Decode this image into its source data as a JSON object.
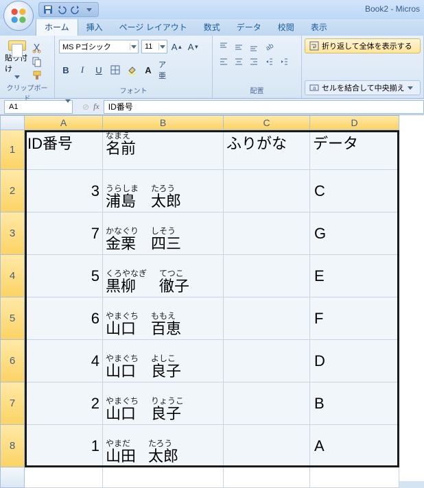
{
  "window": {
    "title": "Book2 - Micros"
  },
  "tabs": {
    "home": "ホーム",
    "insert": "挿入",
    "layout": "ページ レイアウト",
    "formula": "数式",
    "data": "データ",
    "review": "校閲",
    "view": "表示"
  },
  "ribbon": {
    "clipboard": {
      "paste": "貼り付け",
      "title": "クリップボード"
    },
    "font": {
      "name": "MS Pゴシック",
      "size": "11",
      "title": "フォント"
    },
    "align": {
      "wrap": "折り返して全体を表示する",
      "merge": "セルを結合して中央揃え",
      "title": "配置"
    }
  },
  "namebox": "A1",
  "formula_bar": "ID番号",
  "columns": [
    "A",
    "B",
    "C",
    "D"
  ],
  "colwidths": [
    "114",
    "176",
    "126",
    "130"
  ],
  "rows": [
    {
      "n": "1",
      "A": "ID番号",
      "B": {
        "ruby": "なまえ",
        "base": "名前"
      },
      "C": "ふりがな",
      "D": "データ",
      "header": true
    },
    {
      "n": "2",
      "A": "3",
      "B": {
        "r1": "うらしま",
        "b1": "浦島",
        "r2": "たろう",
        "b2": "太郎"
      },
      "D": "C"
    },
    {
      "n": "3",
      "A": "7",
      "B": {
        "r1": "かなぐり",
        "b1": "金栗",
        "r2": "しそう",
        "b2": "四三"
      },
      "D": "G"
    },
    {
      "n": "4",
      "A": "5",
      "B": {
        "r1": "くろやなぎ",
        "b1": "黒柳",
        "r2": "てつこ",
        "b2": "徹子"
      },
      "D": "E"
    },
    {
      "n": "5",
      "A": "6",
      "B": {
        "r1": "やまぐち",
        "b1": "山口",
        "r2": "ももえ",
        "b2": "百恵"
      },
      "D": "F"
    },
    {
      "n": "6",
      "A": "4",
      "B": {
        "r1": "やまぐち",
        "b1": "山口",
        "r2": "よしこ",
        "b2": "良子"
      },
      "D": "D"
    },
    {
      "n": "7",
      "A": "2",
      "B": {
        "r1": "やまぐち",
        "b1": "山口",
        "r2": "りょうこ",
        "b2": "良子"
      },
      "D": "B"
    },
    {
      "n": "8",
      "A": "1",
      "B": {
        "r1": "やまだ",
        "b1": "山田",
        "r2": "たろう",
        "b2": "太郎"
      },
      "D": "A"
    }
  ]
}
